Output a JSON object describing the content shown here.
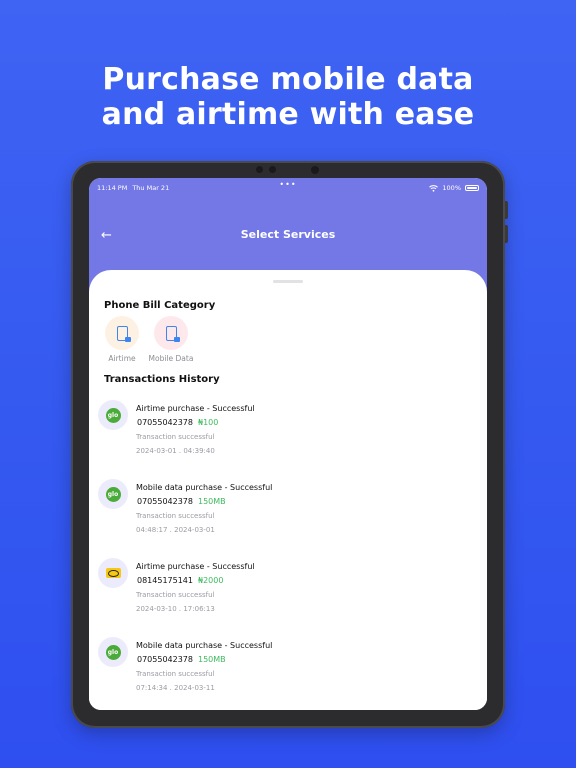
{
  "headline": {
    "line1": "Purchase mobile data",
    "line2": "and airtime with ease"
  },
  "status_bar": {
    "time": "11:14 PM",
    "date": "Thu Mar 21",
    "dots": "•••",
    "battery": "100%"
  },
  "header": {
    "back_icon": "←",
    "title": "Select Services"
  },
  "phone_bill": {
    "title": "Phone Bill Category",
    "categories": [
      {
        "label": "Airtime",
        "bg": "#fdf1e3",
        "icon": "phone-icon"
      },
      {
        "label": "Mobile Data",
        "bg": "#fde9ec",
        "icon": "phone-icon"
      }
    ]
  },
  "transactions": {
    "title": "Transactions History",
    "items": [
      {
        "title": "Airtime purchase - Successful",
        "number": "07055042378",
        "amount": "₦100",
        "status": "Transaction successful",
        "time": "2024-03-01 . 04:39:40",
        "network": "glo"
      },
      {
        "title": "Mobile data purchase - Successful",
        "number": "07055042378",
        "amount": "150MB",
        "status": "Transaction successful",
        "time": "04:48:17 . 2024-03-01",
        "network": "glo"
      },
      {
        "title": "Airtime purchase - Successful",
        "number": "08145175141",
        "amount": "₦2000",
        "status": "Transaction successful",
        "time": "2024-03-10 . 17:06:13",
        "network": "mtn"
      },
      {
        "title": "Mobile data purchase - Successful",
        "number": "07055042378",
        "amount": "150MB",
        "status": "Transaction successful",
        "time": "07:14:34 . 2024-03-11",
        "network": "glo"
      }
    ]
  },
  "colors": {
    "background": "#3f63f3",
    "header": "#7478e6",
    "amount": "#3dbb5e"
  }
}
